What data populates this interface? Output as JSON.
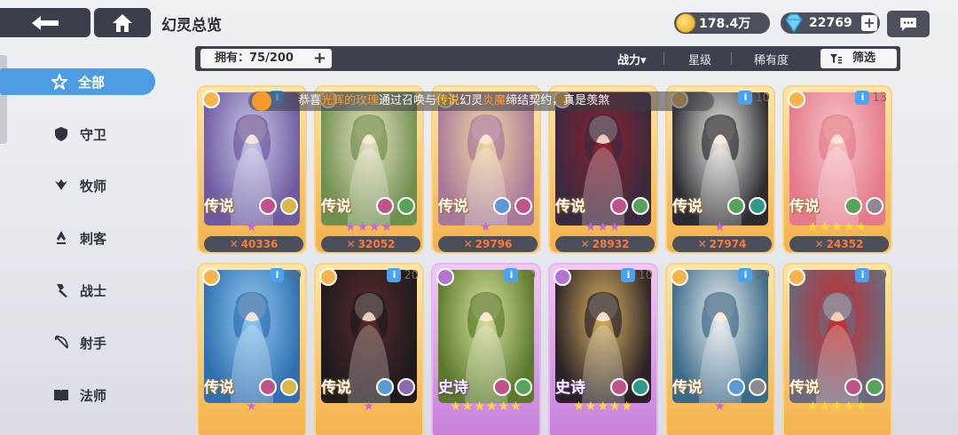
{
  "header": {
    "title": "幻灵总览",
    "gold": "178.4万",
    "gems": "22769",
    "gems_plus": "+"
  },
  "toolbar": {
    "owned_label": "拥有：75/200",
    "owned_icon": "+",
    "sort_power": "战力▾",
    "sort_star": "星级",
    "sort_rarity": "稀有度",
    "filter_label": "筛选"
  },
  "announcement": {
    "prefix": "恭喜",
    "player": "光辉的玫瑰",
    "middle": "通过召唤与",
    "rarity": "传说",
    "middle2": "幻灵",
    "hero": "炎魔",
    "suffix": "缔结契约，真是羡煞"
  },
  "sidebar": {
    "items": [
      {
        "label": "全部",
        "icon": "all-star-icon",
        "active": true
      },
      {
        "label": "守卫",
        "icon": "shield-icon",
        "active": false
      },
      {
        "label": "牧师",
        "icon": "wings-icon",
        "active": false
      },
      {
        "label": "刺客",
        "icon": "dagger-icon",
        "active": false
      },
      {
        "label": "战士",
        "icon": "axe-icon",
        "active": false
      },
      {
        "label": "射手",
        "icon": "bow-icon",
        "active": false
      },
      {
        "label": "法师",
        "icon": "book-icon",
        "active": false
      }
    ]
  },
  "cards": [
    {
      "rarity": "传说",
      "stars": "★",
      "power": "40336",
      "level": "20",
      "tier": "gold",
      "elements": [
        "#c0538a",
        "#d9b64a"
      ],
      "art": [
        "#c9c7e8",
        "#6e5aa0"
      ]
    },
    {
      "rarity": "传说",
      "stars": "★★★★",
      "power": "32052",
      "level": "",
      "tier": "gold",
      "elements": [
        "#c0538a",
        "#57a35a"
      ],
      "art": [
        "#e8e3c2",
        "#6f8f4e"
      ]
    },
    {
      "rarity": "传说",
      "stars": "★",
      "power": "29796",
      "level": "",
      "tier": "gold",
      "elements": [
        "#5a9ad4",
        "#c0538a"
      ],
      "art": [
        "#f3d8a0",
        "#a8789a"
      ]
    },
    {
      "rarity": "传说",
      "stars": "★★★",
      "power": "28932",
      "level": "",
      "tier": "gold",
      "elements": [
        "#c0538a",
        "#57a35a"
      ],
      "art": [
        "#8a2030",
        "#3a2a40"
      ]
    },
    {
      "rarity": "传说",
      "stars": "★",
      "power": "27974",
      "level": "10",
      "tier": "gold",
      "elements": [
        "#57a35a",
        "#2f9a8a"
      ],
      "art": [
        "#f3efe6",
        "#2b2b33"
      ]
    },
    {
      "rarity": "传说",
      "stars": "★★★★★",
      "power": "24352",
      "level": "13",
      "tier": "gold",
      "elements": [
        "#57a35a",
        "#8a8a90"
      ],
      "art": [
        "#f7c4c8",
        "#e47a8a"
      ]
    },
    {
      "rarity": "传说",
      "stars": "★",
      "power": "",
      "level": "20",
      "tier": "gold",
      "elements": [
        "#c0538a",
        "#d9b64a"
      ],
      "art": [
        "#8ec9f0",
        "#2f6fb0"
      ]
    },
    {
      "rarity": "传说",
      "stars": "★",
      "power": "",
      "level": "20",
      "tier": "gold",
      "elements": [
        "#5a9ad4",
        "#8a6ab0"
      ],
      "art": [
        "#5a2a2a",
        "#1e1a1e"
      ]
    },
    {
      "rarity": "史诗",
      "stars": "★★★★★★",
      "power": "",
      "level": "20",
      "tier": "purple",
      "elements": [
        "#c0538a",
        "#57a35a"
      ],
      "art": [
        "#d8e0a0",
        "#5a7a2a"
      ]
    },
    {
      "rarity": "史诗",
      "stars": "★★★★★",
      "power": "",
      "level": "10",
      "tier": "purple",
      "elements": [
        "#c0538a",
        "#2f9a8a"
      ],
      "art": [
        "#d8b060",
        "#2a2226"
      ]
    },
    {
      "rarity": "传说",
      "stars": "★",
      "power": "",
      "level": "20",
      "tier": "gold",
      "elements": [
        "#5a9ad4",
        "#8a8a90"
      ],
      "art": [
        "#eef0f0",
        "#3a6a8a"
      ]
    },
    {
      "rarity": "传说",
      "stars": "★★★★★",
      "power": "",
      "level": "20",
      "tier": "gold",
      "elements": [
        "#c0538a",
        "#57a35a"
      ],
      "art": [
        "#c82a2a",
        "#6a6a80"
      ]
    }
  ]
}
